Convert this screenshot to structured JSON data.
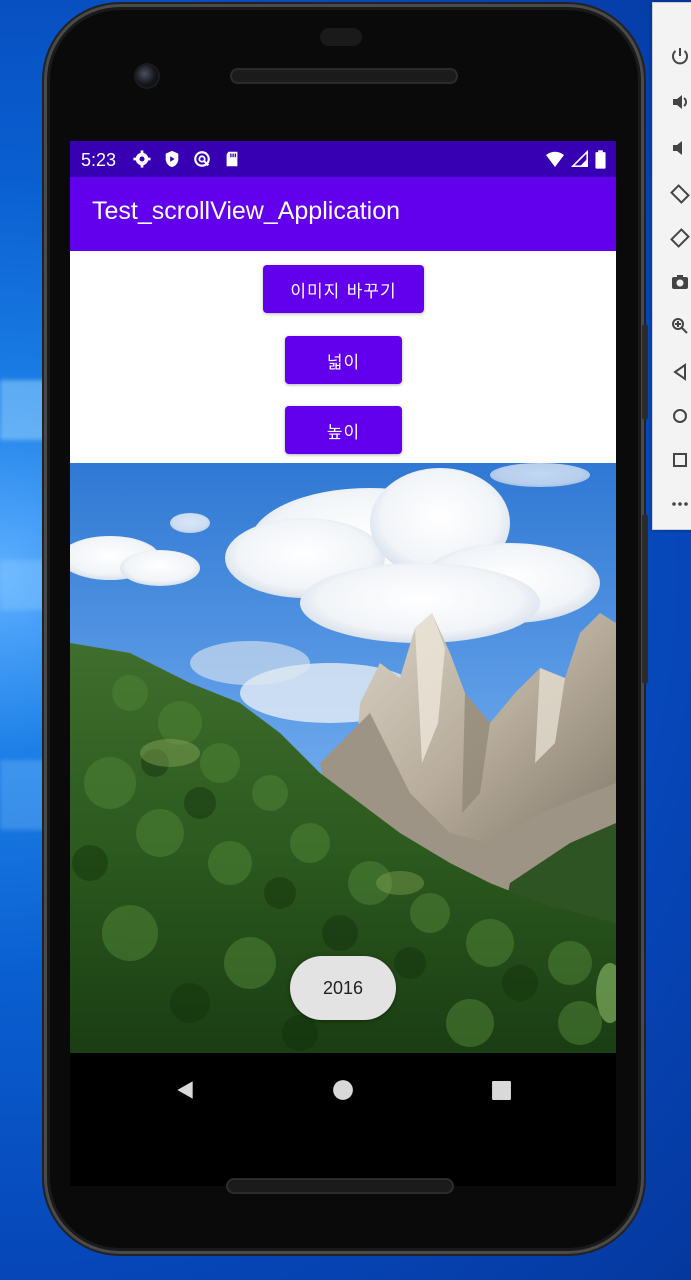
{
  "status_bar": {
    "time": "5:23",
    "icons": [
      "settings-icon",
      "shield-icon",
      "sync-icon",
      "sd-card-icon"
    ],
    "right_icons": [
      "wifi-icon",
      "signal-icon",
      "battery-icon"
    ]
  },
  "app": {
    "title": "Test_scrollView_Application",
    "buttons": {
      "change_image": "이미지 바꾸기",
      "width": "넓이",
      "height": "높이"
    },
    "toast": "2016"
  },
  "nav_bar": {
    "back": "back-icon",
    "home": "home-icon",
    "recents": "recents-icon"
  },
  "emulator_toolbar": {
    "items": [
      "power-icon",
      "volume-up-icon",
      "volume-down-icon",
      "rotate-left-icon",
      "rotate-right-icon",
      "camera-icon",
      "zoom-icon",
      "back-icon",
      "home-icon",
      "overview-icon",
      "more-icon"
    ]
  },
  "colors": {
    "status_bar": "#3700b3",
    "app_bar": "#6200ee",
    "button": "#6200ee"
  }
}
